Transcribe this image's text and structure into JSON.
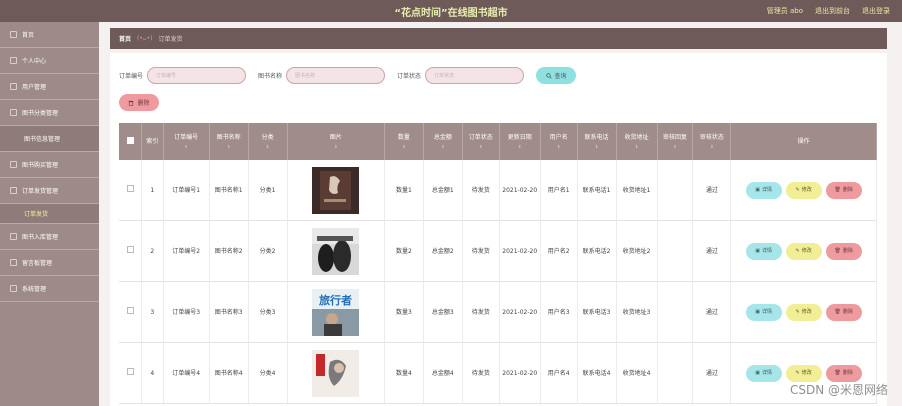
{
  "header": {
    "title": "“花点时间”在线图书超市",
    "admin": "管理员 abo",
    "exit_backend": "退出到前台",
    "logout": "退出登录"
  },
  "sidebar": {
    "items": [
      {
        "label": "首页"
      },
      {
        "label": "个人中心"
      },
      {
        "label": "用户管理"
      },
      {
        "label": "图书分类管理"
      },
      {
        "label": "图书信息管理"
      },
      {
        "label": "图书购买管理"
      },
      {
        "label": "订单发货管理"
      },
      {
        "label": "订单发货"
      },
      {
        "label": "图书入库管理"
      },
      {
        "label": "留言板管理"
      },
      {
        "label": "系统管理"
      }
    ]
  },
  "breadcrumb": {
    "home": "首页",
    "face": "(•ᴗ•)",
    "current": "订单发货"
  },
  "search": {
    "order_no_label": "订单编号",
    "order_no_placeholder": "订单编号",
    "book_name_label": "图书名称",
    "book_name_placeholder": "图书名称",
    "status_label": "订单状态",
    "status_placeholder": "订单状态",
    "query_button": "查询"
  },
  "delete_button": "删除",
  "table": {
    "headers": {
      "index": "索引",
      "order_no": "订单编号",
      "book_name": "图书名称",
      "category": "分类",
      "image": "图片",
      "quantity": "数量",
      "total": "总金额",
      "order_status": "订单状态",
      "update_date": "更新日期",
      "username": "用户名",
      "phone": "联系电话",
      "address": "收货地址",
      "review_reply": "审核回复",
      "review_status": "审核状态",
      "actions": "操作"
    },
    "rows": [
      {
        "index": "1",
        "order_no": "订单编号1",
        "book_name": "图书名称1",
        "category": "分类1",
        "quantity": "数量1",
        "total": "总金额1",
        "order_status": "待发货",
        "update_date": "2021-02-20",
        "username": "用户名1",
        "phone": "联系电话1",
        "address": "收货地址1",
        "review_reply": "",
        "review_status": "通过"
      },
      {
        "index": "2",
        "order_no": "订单编号2",
        "book_name": "图书名称2",
        "category": "分类2",
        "quantity": "数量2",
        "total": "总金额2",
        "order_status": "待发货",
        "update_date": "2021-02-20",
        "username": "用户名2",
        "phone": "联系电话2",
        "address": "收货地址2",
        "review_reply": "",
        "review_status": "通过"
      },
      {
        "index": "3",
        "order_no": "订单编号3",
        "book_name": "图书名称3",
        "category": "分类3",
        "quantity": "数量3",
        "total": "总金额3",
        "order_status": "待发货",
        "update_date": "2021-02-20",
        "username": "用户名3",
        "phone": "联系电话3",
        "address": "收货地址3",
        "review_reply": "",
        "review_status": "通过"
      },
      {
        "index": "4",
        "order_no": "订单编号4",
        "book_name": "图书名称4",
        "category": "分类4",
        "quantity": "数量4",
        "total": "总金额4",
        "order_status": "待发货",
        "update_date": "2021-02-20",
        "username": "用户名4",
        "phone": "联系电话4",
        "address": "收货地址4",
        "review_reply": "",
        "review_status": "通过"
      }
    ],
    "image_texts": [
      "旅行者"
    ],
    "actions": {
      "detail": "详情",
      "edit": "修改",
      "remove": "删除"
    }
  },
  "watermark": "CSDN @米恩网络"
}
